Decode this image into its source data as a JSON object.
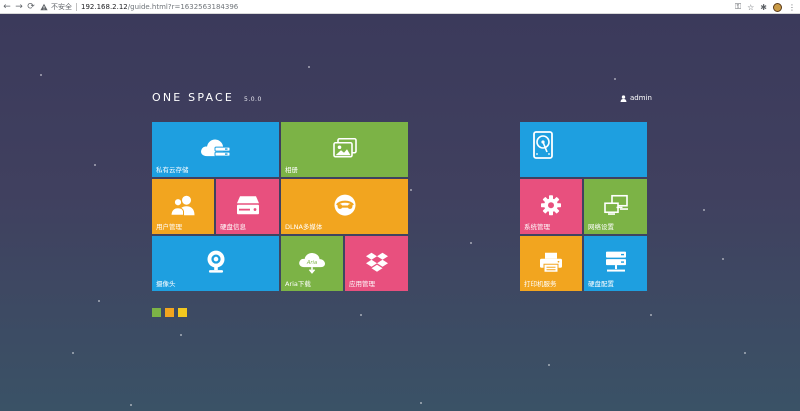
{
  "browser": {
    "insecure_label": "不安全",
    "url_host": "192.168.2.12",
    "url_path": "/guide.html?r=1632563184396",
    "back_icon": "arrow-left-icon",
    "forward_icon": "arrow-right-icon",
    "reload_icon": "reload-icon"
  },
  "header": {
    "brand": "ONE SPACE",
    "version": "5.0.0",
    "user": "admin"
  },
  "tiles": {
    "cloud_storage": {
      "label": "私有云存储",
      "color": "#1e9fe0",
      "icon": "cloud-server-icon"
    },
    "photos": {
      "label": "相册",
      "color": "#7cb346",
      "icon": "photo-album-icon"
    },
    "users": {
      "label": "用户管理",
      "color": "#f2a51f",
      "icon": "users-icon"
    },
    "disk_info": {
      "label": "硬盘信息",
      "color": "#e8507e",
      "icon": "hard-drive-icon"
    },
    "dlna": {
      "label": "DLNA多媒体",
      "color": "#f2a51f",
      "icon": "dlna-icon"
    },
    "camera": {
      "label": "摄像头",
      "color": "#1e9fe0",
      "icon": "webcam-icon"
    },
    "aria": {
      "label": "Aria下载",
      "color": "#7cb346",
      "icon": "aria-download-icon",
      "icon_text": "Aria"
    },
    "app_manage": {
      "label": "应用管理",
      "color": "#e8507e",
      "icon": "dropbox-icon"
    },
    "disk_top": {
      "label": "",
      "color": "#1e9fe0",
      "icon": "hard-disk-icon"
    },
    "system": {
      "label": "系统管理",
      "color": "#e8507e",
      "icon": "gear-icon"
    },
    "network": {
      "label": "网络设置",
      "color": "#7cb346",
      "icon": "network-icon"
    },
    "printer": {
      "label": "打印机服务",
      "color": "#f2a51f",
      "icon": "printer-icon"
    },
    "disk_config": {
      "label": "硬盘配置",
      "color": "#1e9fe0",
      "icon": "server-stack-icon"
    }
  },
  "theme_dots": [
    "#7cb346",
    "#f2a51f",
    "#f2c81f"
  ]
}
